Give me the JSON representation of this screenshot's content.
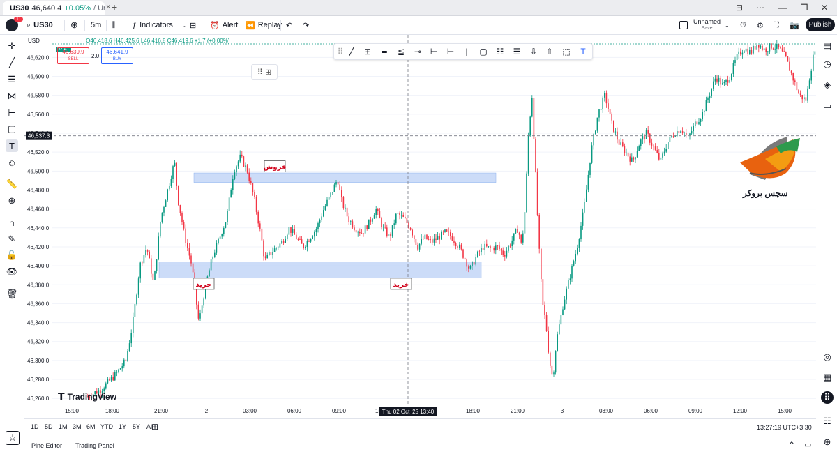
{
  "browser": {
    "tab_symbol": "US30",
    "tab_price": "46,640.4",
    "tab_change": "+0.05%",
    "tab_name": "/ Unna",
    "tab_close": "×",
    "new_tab": "+"
  },
  "toolbar": {
    "symbol": "US30",
    "interval": "5m",
    "indicators_label": "Indicators",
    "alert_label": "Alert",
    "replay_label": "Replay",
    "layout_name": "Unnamed",
    "layout_status": "Save",
    "publish_label": "Publish",
    "notification_count": "11"
  },
  "legend": {
    "currency": "USD",
    "ohlc": "O46,418.6  H46,425.6  L46,416.8  C46,419.6  +1.7 (+0.00%)",
    "sell_price": "46,639.9",
    "sell_label": "SELL",
    "spread": "2.0",
    "buy_price": "46,641.9",
    "buy_label": "BUY",
    "top_left_label": "02:41",
    "last_price_label": "46,537.3"
  },
  "chart_data": {
    "type": "candlestick",
    "symbol": "US30",
    "interval": "5m",
    "y_axis_ticks": [
      "46,620.0",
      "46,600.0",
      "46,580.0",
      "46,560.0",
      "46,540.0",
      "46,520.0",
      "46,500.0",
      "46,480.0",
      "46,460.0",
      "46,440.0",
      "46,420.0",
      "46,400.0",
      "46,380.0",
      "46,360.0",
      "46,340.0",
      "46,320.0",
      "46,300.0",
      "46,280.0",
      "46,260.0"
    ],
    "x_axis_ticks": [
      "15:00",
      "18:00",
      "21:00",
      "2",
      "03:00",
      "06:00",
      "09:00",
      "15:00",
      "18:00",
      "21:00",
      "3",
      "03:00",
      "06:00",
      "09:00",
      "12:00",
      "15:00"
    ],
    "crosshair_label": "Thu 02 Oct '25   13:40",
    "crosshair_price": 46537.3,
    "ylim": [
      46255,
      46635
    ],
    "zones": [
      {
        "label": "فروش",
        "top": 46498,
        "bottom": 46488
      },
      {
        "label": "خرید",
        "top": 46404,
        "bottom": 46387
      }
    ],
    "zone_labels": [
      "فروش",
      "خرید",
      "خرید"
    ],
    "price_path": [
      [
        0,
        46262
      ],
      [
        4,
        46270
      ],
      [
        8,
        46285
      ],
      [
        11,
        46300
      ],
      [
        13,
        46340
      ],
      [
        15,
        46400
      ],
      [
        17,
        46420
      ],
      [
        19,
        46380
      ],
      [
        21,
        46450
      ],
      [
        23,
        46480
      ],
      [
        25,
        46510
      ],
      [
        26,
        46470
      ],
      [
        28,
        46430
      ],
      [
        30,
        46400
      ],
      [
        32,
        46340
      ],
      [
        34,
        46380
      ],
      [
        36,
        46410
      ],
      [
        38,
        46430
      ],
      [
        40,
        46450
      ],
      [
        42,
        46500
      ],
      [
        44,
        46515
      ],
      [
        46,
        46500
      ],
      [
        48,
        46470
      ],
      [
        50,
        46430
      ],
      [
        51,
        46405
      ],
      [
        52,
        46410
      ],
      [
        53,
        46415
      ],
      [
        54,
        46418
      ],
      [
        56,
        46425
      ],
      [
        58,
        46440
      ],
      [
        60,
        46430
      ],
      [
        62,
        46420
      ],
      [
        64,
        46430
      ],
      [
        66,
        46440
      ],
      [
        68,
        46460
      ],
      [
        70,
        46475
      ],
      [
        72,
        46492
      ],
      [
        73,
        46470
      ],
      [
        75,
        46450
      ],
      [
        77,
        46440
      ],
      [
        79,
        46435
      ],
      [
        81,
        46445
      ],
      [
        83,
        46460
      ],
      [
        85,
        46440
      ],
      [
        87,
        46430
      ],
      [
        89,
        46455
      ],
      [
        91,
        46450
      ],
      [
        93,
        46440
      ],
      [
        95,
        46420
      ],
      [
        97,
        46430
      ],
      [
        99,
        46425
      ],
      [
        101,
        46430
      ],
      [
        103,
        46435
      ],
      [
        105,
        46430
      ],
      [
        107,
        46420
      ],
      [
        109,
        46405
      ],
      [
        110,
        46395
      ],
      [
        112,
        46410
      ],
      [
        114,
        46420
      ],
      [
        116,
        46418
      ],
      [
        118,
        46420
      ],
      [
        120,
        46412
      ],
      [
        122,
        46425
      ],
      [
        124,
        46440
      ],
      [
        125,
        46420
      ],
      [
        126,
        46460
      ],
      [
        127,
        46540
      ],
      [
        128,
        46580
      ],
      [
        129,
        46500
      ],
      [
        130,
        46420
      ],
      [
        131,
        46360
      ],
      [
        132,
        46340
      ],
      [
        133,
        46300
      ],
      [
        134,
        46280
      ],
      [
        135,
        46320
      ],
      [
        137,
        46360
      ],
      [
        139,
        46390
      ],
      [
        141,
        46420
      ],
      [
        143,
        46460
      ],
      [
        145,
        46520
      ],
      [
        147,
        46560
      ],
      [
        149,
        46580
      ],
      [
        151,
        46550
      ],
      [
        153,
        46530
      ],
      [
        155,
        46520
      ],
      [
        157,
        46510
      ],
      [
        159,
        46530
      ],
      [
        161,
        46540
      ],
      [
        163,
        46525
      ],
      [
        165,
        46510
      ],
      [
        167,
        46530
      ],
      [
        169,
        46540
      ],
      [
        171,
        46545
      ],
      [
        173,
        46535
      ],
      [
        175,
        46550
      ],
      [
        177,
        46560
      ],
      [
        179,
        46580
      ],
      [
        181,
        46600
      ],
      [
        183,
        46590
      ],
      [
        185,
        46600
      ],
      [
        187,
        46620
      ],
      [
        189,
        46630
      ],
      [
        191,
        46625
      ],
      [
        193,
        46635
      ],
      [
        195,
        46628
      ],
      [
        197,
        46632
      ],
      [
        199,
        46630
      ],
      [
        201,
        46620
      ],
      [
        203,
        46600
      ],
      [
        205,
        46580
      ],
      [
        207,
        46575
      ],
      [
        208,
        46600
      ],
      [
        210,
        46640
      ]
    ]
  },
  "bottom": {
    "ranges": [
      "1D",
      "5D",
      "1M",
      "3M",
      "6M",
      "YTD",
      "1Y",
      "5Y",
      "All"
    ],
    "clock": "13:27:19 UTC+3:30"
  },
  "footer": {
    "pine_editor": "Pine Editor",
    "trading_panel": "Trading Panel"
  },
  "watermark": {
    "tradingview": "TradingView",
    "broker_text": "سچس بروکر"
  },
  "colors": {
    "up": "#089981",
    "down": "#f23645",
    "zone": "#bbd0f5",
    "zone_border": "#8ab0ee",
    "label_red": "#d0021b"
  }
}
